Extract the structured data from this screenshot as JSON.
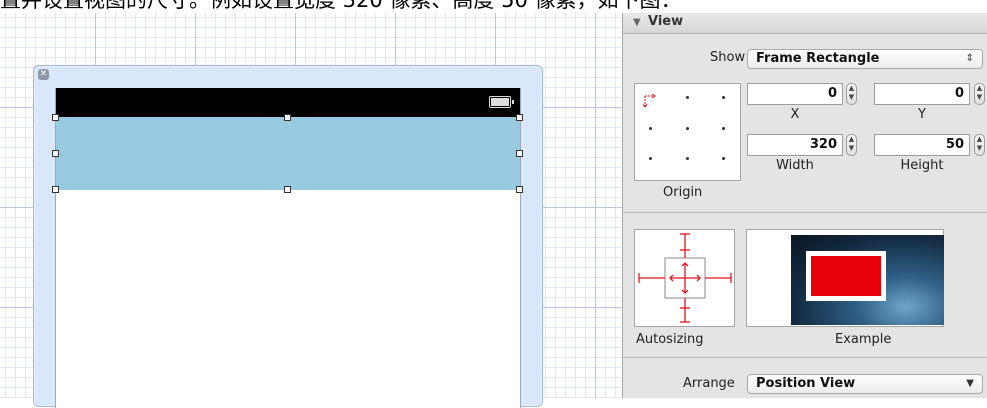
{
  "caption": "置并设置视图的尺寸。例如设置宽度 320 像素、高度 50 像素，如下图：",
  "inspector": {
    "section_title": "View",
    "show_label": "Show",
    "show_value": "Frame Rectangle",
    "origin_label": "Origin",
    "fields": {
      "x": {
        "value": "0",
        "label": "X"
      },
      "y": {
        "value": "0",
        "label": "Y"
      },
      "width": {
        "value": "320",
        "label": "Width"
      },
      "height": {
        "value": "50",
        "label": "Height"
      }
    },
    "autosizing_label": "Autosizing",
    "example_label": "Example",
    "arrange_label": "Arrange",
    "arrange_value": "Position View"
  },
  "colors": {
    "selected_view": "#97c9e0",
    "autosizing_struts": "#e0141e",
    "example_rect": "#e8000a"
  }
}
